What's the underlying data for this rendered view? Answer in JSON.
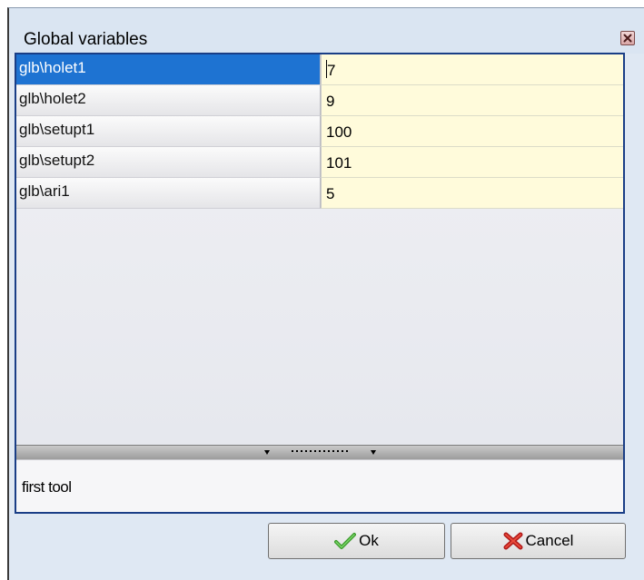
{
  "dialog": {
    "title": "Global variables",
    "close_icon": "close-icon"
  },
  "variables": [
    {
      "name": "glb\\holet1",
      "value": "7",
      "selected": true
    },
    {
      "name": "glb\\holet2",
      "value": "9",
      "selected": false
    },
    {
      "name": "glb\\setupt1",
      "value": "100",
      "selected": false
    },
    {
      "name": "glb\\setupt2",
      "value": "101",
      "selected": false
    },
    {
      "name": "glb\\ari1",
      "value": "5",
      "selected": false
    }
  ],
  "description": {
    "text": "first tool"
  },
  "buttons": {
    "ok_label": "Ok",
    "ok_icon": "checkmark-icon",
    "cancel_label": "Cancel",
    "cancel_icon": "red-x-icon"
  },
  "colors": {
    "selection": "#1e73d2",
    "value_background": "#fffbdb",
    "frame_border": "#1a3e86"
  }
}
